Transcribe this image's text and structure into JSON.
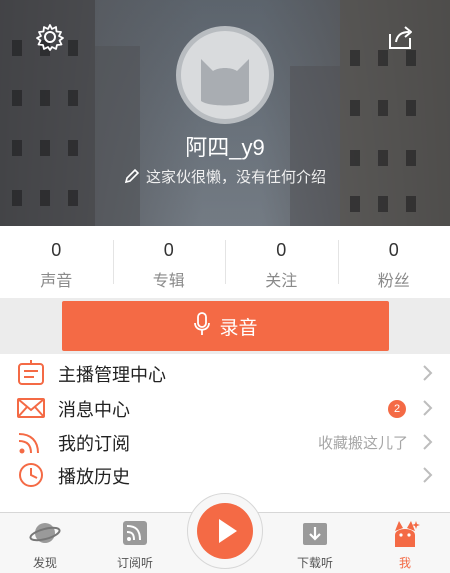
{
  "profile": {
    "username": "阿四_y9",
    "signature": "这家伙很懒，没有任何介绍"
  },
  "stats": [
    {
      "value": "0",
      "label": "声音"
    },
    {
      "value": "0",
      "label": "专辑"
    },
    {
      "value": "0",
      "label": "关注"
    },
    {
      "value": "0",
      "label": "粉丝"
    }
  ],
  "record_button": {
    "label": "录音"
  },
  "menu": [
    {
      "label": "主播管理中心",
      "icon": "host-manage-icon"
    },
    {
      "label": "消息中心",
      "icon": "mail-icon",
      "badge": "2"
    },
    {
      "label": "我的订阅",
      "icon": "rss-icon",
      "hint": "收藏搬这儿了"
    },
    {
      "label": "播放历史",
      "icon": "clock-icon"
    }
  ],
  "tabs": [
    {
      "label": "发现",
      "icon": "planet-icon"
    },
    {
      "label": "订阅听",
      "icon": "rss-icon"
    },
    {
      "label": "下载听",
      "icon": "download-icon"
    },
    {
      "label": "我",
      "icon": "user-icon"
    }
  ],
  "colors": {
    "accent": "#f46a45",
    "text_primary": "#222222",
    "text_secondary": "#8a8a8a"
  }
}
